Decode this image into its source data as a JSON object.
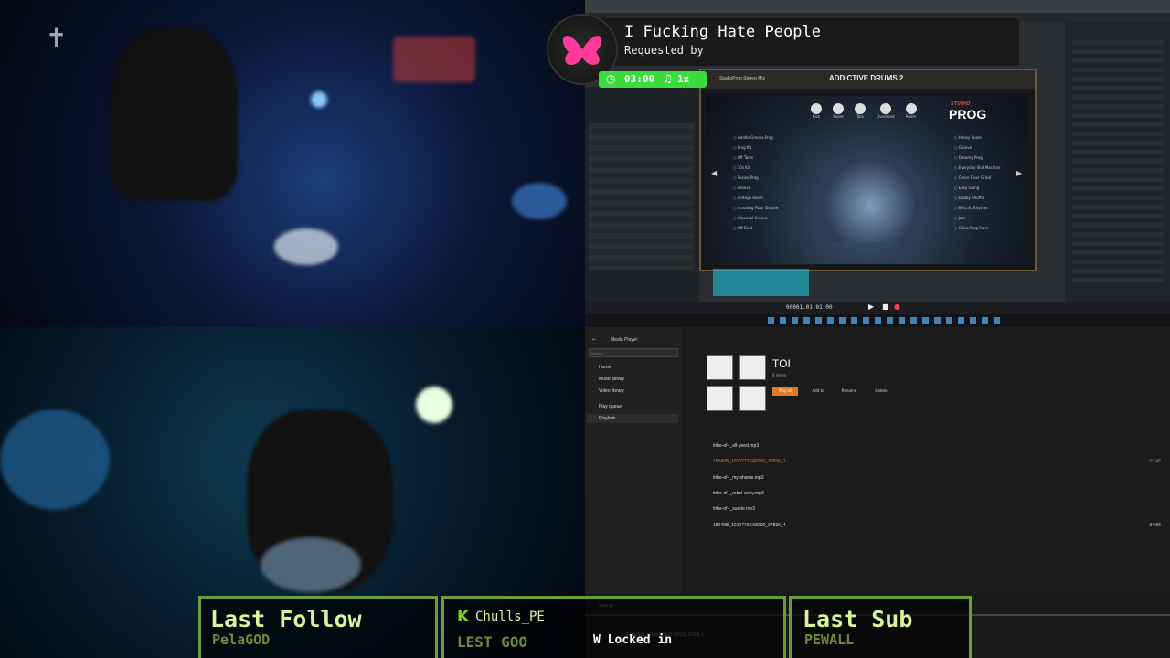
{
  "song": {
    "title": "I Fucking Hate People",
    "requested_by": "Requested by",
    "timer": "03:00",
    "speed": "1x",
    "note_icon": "music-note-icon"
  },
  "daw": {
    "plugin_brand": "ADDICTIVE DRUMS 2",
    "kit_name": "PROG",
    "kit_sub": "STUDIO",
    "preset": "StudioProg Stereo Mix",
    "knobs": [
      "Kick",
      "Snare",
      "Tom",
      "Overhead",
      "Room"
    ],
    "left_presets": [
      "Gentle Groove Prog",
      "Prog Kit",
      "Off Toms",
      "70s Kit",
      "Fusion Prog",
      "Groove",
      "Vintage Room",
      "Cracking Floor Groove",
      "Classical Groove",
      "Off Beat"
    ],
    "right_presets": [
      "Heavy Room",
      "Groove",
      "Dreamy Prog",
      "Everyday Slot Machine",
      "Cover Floor Grind",
      "Easy Going",
      "Dubby Shuffle",
      "Electric Rhythm",
      "Jam",
      "Glass Prog Conn"
    ],
    "timecode": "00001.01.01.00"
  },
  "media": {
    "app": "Media Player",
    "search_placeholder": "Search",
    "nav": [
      "Home",
      "Music library",
      "Video library",
      "Play queue",
      "Playlists"
    ],
    "playlist_title": "TOI",
    "playlist_count": "6 items",
    "actions": [
      "Play all",
      "Add to",
      "Rename",
      "Delete"
    ],
    "tracks": [
      {
        "name": "tribe-of-i_all-good.mp3",
        "duration": ""
      },
      {
        "name": "18040B_1010773SA8200_27836_1",
        "duration": "03:46"
      },
      {
        "name": "tribe-of-i_my-shame.mp3",
        "duration": ""
      },
      {
        "name": "tribe-of-i_rebel-army.mp3",
        "duration": ""
      },
      {
        "name": "tribe-of-i_suede.mp3",
        "duration": ""
      },
      {
        "name": "18040B_1010773SA8200_27836_4",
        "duration": "04:56"
      }
    ],
    "settings": "Settings",
    "now_playing": "12113040_10104795477795551_25708_n"
  },
  "overlays": {
    "last_follow_label": "Last Follow",
    "last_follow_name": "PelaGOD",
    "chat_user": "Chulls_PE",
    "chat_msg": "LEST GOO",
    "chat_badge": "W Locked in",
    "last_sub_label": "Last Sub",
    "last_sub_name": "PEWALL"
  },
  "colors": {
    "accent_green": "#3ddc3d",
    "overlay_border": "#6b9e3a",
    "pixel_text": "#d8f59c",
    "media_accent": "#e07a2a"
  }
}
